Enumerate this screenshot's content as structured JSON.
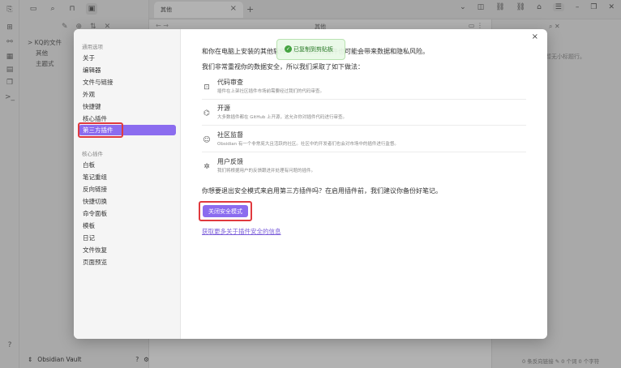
{
  "sidebar": {
    "tree": [
      "> KQ的文件",
      "其他",
      "主题式"
    ],
    "vault_name": "Obsidian Vault"
  },
  "tabs": [
    {
      "label": "其他"
    }
  ],
  "editor": {
    "title": "其他"
  },
  "rightpane": {
    "hint": "暂无小标题行。"
  },
  "statusbar": {
    "text": "0 条反向链接  ✎  0 个词  0 个字符"
  },
  "settings": {
    "sections": [
      {
        "heading": "通用选项",
        "items": [
          "关于",
          "编辑器",
          "文件与链接",
          "外观",
          "快捷键",
          "核心插件",
          "第三方插件"
        ]
      },
      {
        "heading": "核心插件",
        "items": [
          "白板",
          "笔记重组",
          "反向链接",
          "快捷切换",
          "命令面板",
          "模板",
          "日记",
          "文件恢复",
          "页面预览"
        ]
      }
    ],
    "active_item": "第三方插件"
  },
  "modal": {
    "intro": "和你在电脑上安装的其他软件一样，第三方插件也可能会带来数据和隐私风险。",
    "intro2": "我们非常重视你的数据安全，所以我们采取了如下做法：",
    "features": [
      {
        "icon": "code-review-icon",
        "title": "代码审查",
        "desc": "插件在上架社区插件市场前需要经过我们的代码审查。"
      },
      {
        "icon": "github-icon",
        "title": "开源",
        "desc": "大多数插件都在 GitHub 上开源，这允许你对插件代码进行审查。"
      },
      {
        "icon": "community-icon",
        "title": "社区监督",
        "desc": "Obsidian 有一个非常庞大且活跃的社区。社区中的开发者们也会对市场中的插件进行监督。"
      },
      {
        "icon": "bug-icon",
        "title": "用户反馈",
        "desc": "我们将根据用户的反馈跟进并处理有问题的插件。"
      }
    ],
    "question": "你想要退出安全模式来启用第三方插件吗？在启用插件前，我们建议你备份好笔记。",
    "button_label": "关闭安全模式",
    "link_text": "获取更多关于插件安全的信息",
    "toast": "已复制到剪贴板"
  },
  "colors": {
    "accent": "#8b6cef",
    "highlight_box": "#e0393e"
  }
}
